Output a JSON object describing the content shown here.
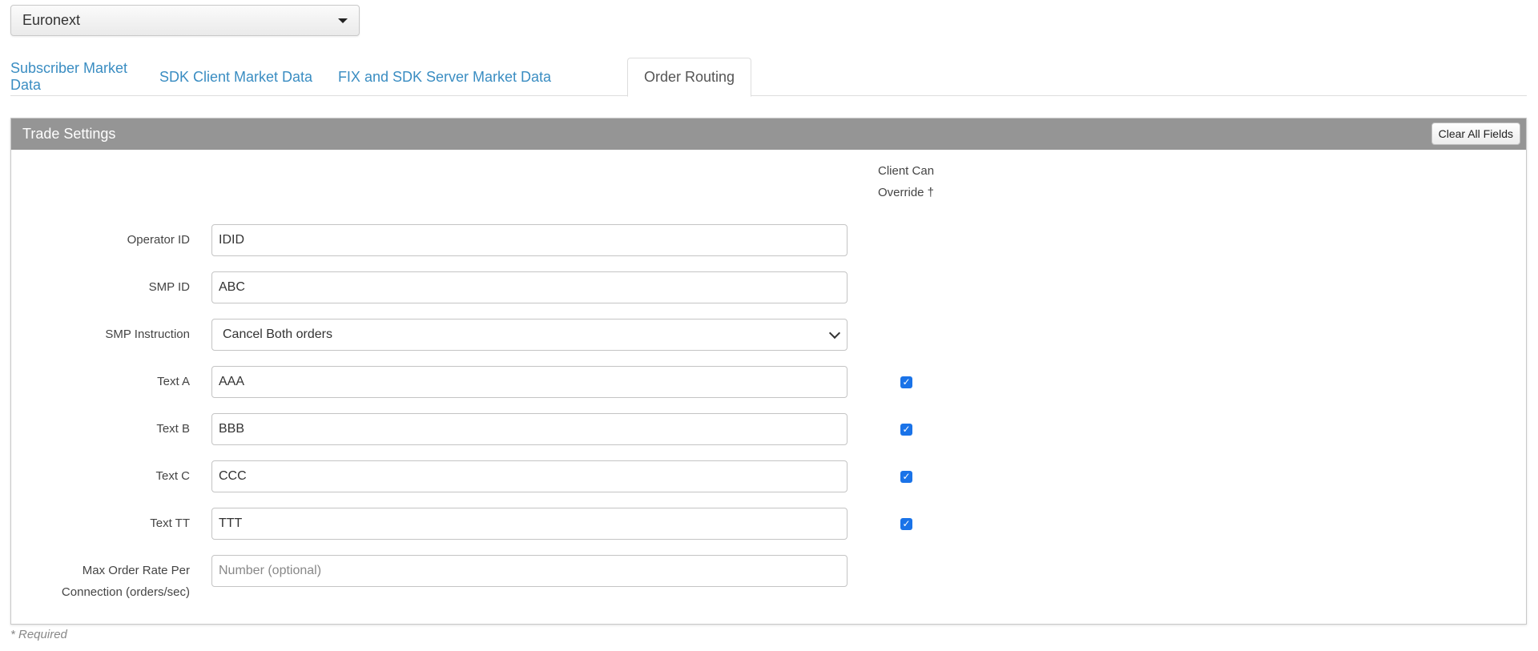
{
  "exchange_select": {
    "value": "Euronext"
  },
  "tabs": [
    {
      "label": "Subscriber Market Data",
      "active": false
    },
    {
      "label": "SDK Client Market Data",
      "active": false
    },
    {
      "label": "FIX and SDK Server Market Data",
      "active": false
    },
    {
      "label": "Order Routing",
      "active": true
    }
  ],
  "panel": {
    "title": "Trade Settings",
    "clear_button": "Clear All Fields",
    "override_header_line1": "Client Can",
    "override_header_line2": "Override †"
  },
  "fields": {
    "operator_id": {
      "label": "Operator ID",
      "value": "IDID"
    },
    "smp_id": {
      "label": "SMP ID",
      "value": "ABC"
    },
    "smp_instruction": {
      "label": "SMP Instruction",
      "value": "Cancel Both orders"
    },
    "text_a": {
      "label": "Text A",
      "value": "AAA",
      "override": true
    },
    "text_b": {
      "label": "Text B",
      "value": "BBB",
      "override": true
    },
    "text_c": {
      "label": "Text C",
      "value": "CCC",
      "override": true
    },
    "text_tt": {
      "label": "Text TT",
      "value": "TTT",
      "override": true
    },
    "max_order_rate": {
      "label_line1": "Max Order Rate Per",
      "label_line2": "Connection (orders/sec)",
      "value": "",
      "placeholder": "Number (optional)"
    }
  },
  "footer": {
    "required_note": "* Required"
  },
  "colors": {
    "link": "#3a8dc2",
    "panel_header": "#959595",
    "checkbox": "#1a73e8"
  }
}
